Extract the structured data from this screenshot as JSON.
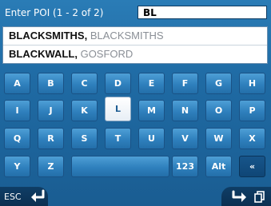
{
  "header": {
    "prompt": "Enter POI (1 - 2 of 2)",
    "query_value": "BL"
  },
  "results": [
    {
      "name": "BLACKSMITHS",
      "separator": ",",
      "locality": "BLACKSMITHS"
    },
    {
      "name": "BLACKWALL",
      "separator": ",",
      "locality": "GOSFORD"
    }
  ],
  "keyboard": {
    "row1": [
      "A",
      "B",
      "C",
      "D",
      "E",
      "F",
      "G",
      "H"
    ],
    "row2": [
      "I",
      "J",
      "K",
      "L",
      "M",
      "N",
      "O",
      "P"
    ],
    "row3": [
      "Q",
      "R",
      "S",
      "T",
      "U",
      "V",
      "W",
      "X"
    ],
    "row4": [
      "Y",
      "Z",
      "",
      "123",
      "Alt",
      "«"
    ],
    "highlighted_key": "L"
  },
  "footer": {
    "esc_label": "ESC",
    "esc_icon": "return-arrow-icon",
    "next_icon": "forward-arrow-icon",
    "extra_icon": "copy-icon"
  },
  "colors": {
    "background": "#1f6aa3",
    "key": "#2f80bd",
    "key_active": "#ffffff",
    "bar": "#0f3e66"
  }
}
